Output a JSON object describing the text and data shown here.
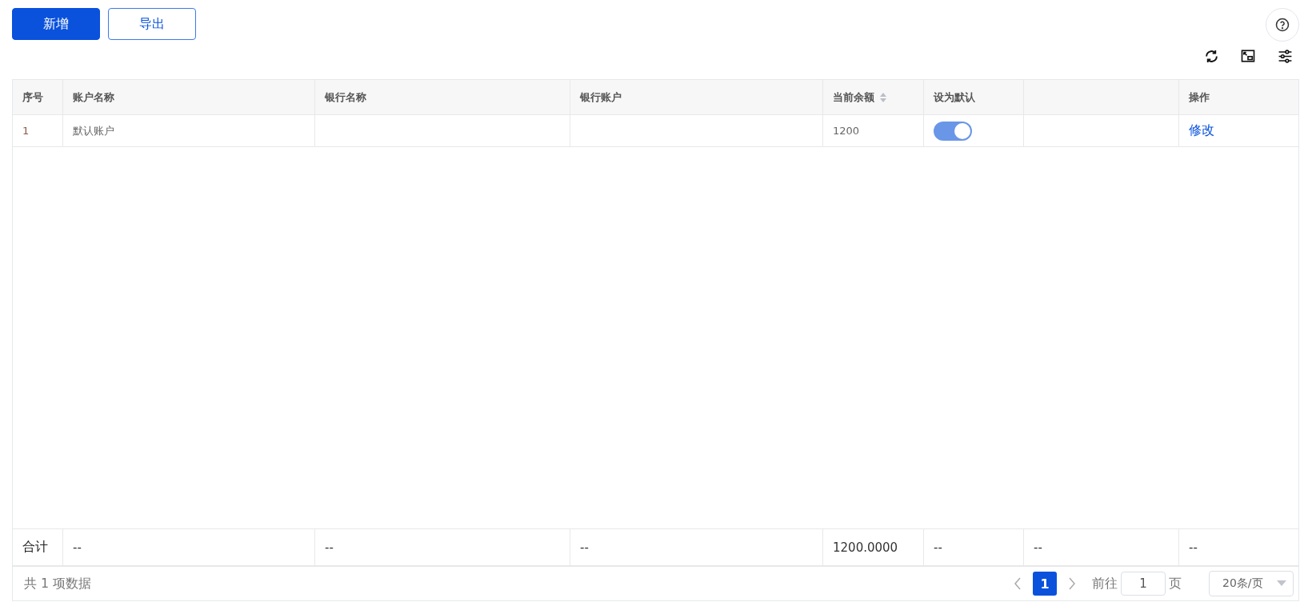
{
  "toolbar": {
    "buttons": [
      {
        "label": "新增",
        "kind": "primary"
      },
      {
        "label": "导出",
        "kind": "outline"
      }
    ]
  },
  "table": {
    "columns": [
      {
        "label": "序号"
      },
      {
        "label": "账户名称"
      },
      {
        "label": "银行名称"
      },
      {
        "label": "银行账户"
      },
      {
        "label": "当前余额",
        "sortable": true
      },
      {
        "label": "设为默认"
      },
      {},
      {
        "label": "操作"
      }
    ],
    "rows": [
      {
        "index": "1",
        "account_name": "默认账户",
        "current_balance": "1200",
        "is_default": {
          "on": true
        },
        "action": "修改"
      }
    ],
    "summary": {
      "label": "合计",
      "cells": [
        "--",
        "--",
        "--",
        "1200.0000",
        "--",
        "--",
        "--"
      ]
    }
  },
  "pagination": {
    "total": "共 1 项数据",
    "pages": [
      {
        "label": "1",
        "selected": true
      }
    ],
    "goto_label": "前往",
    "goto_value": "1",
    "goto_suffix": "页",
    "page_size": "20条/页"
  }
}
